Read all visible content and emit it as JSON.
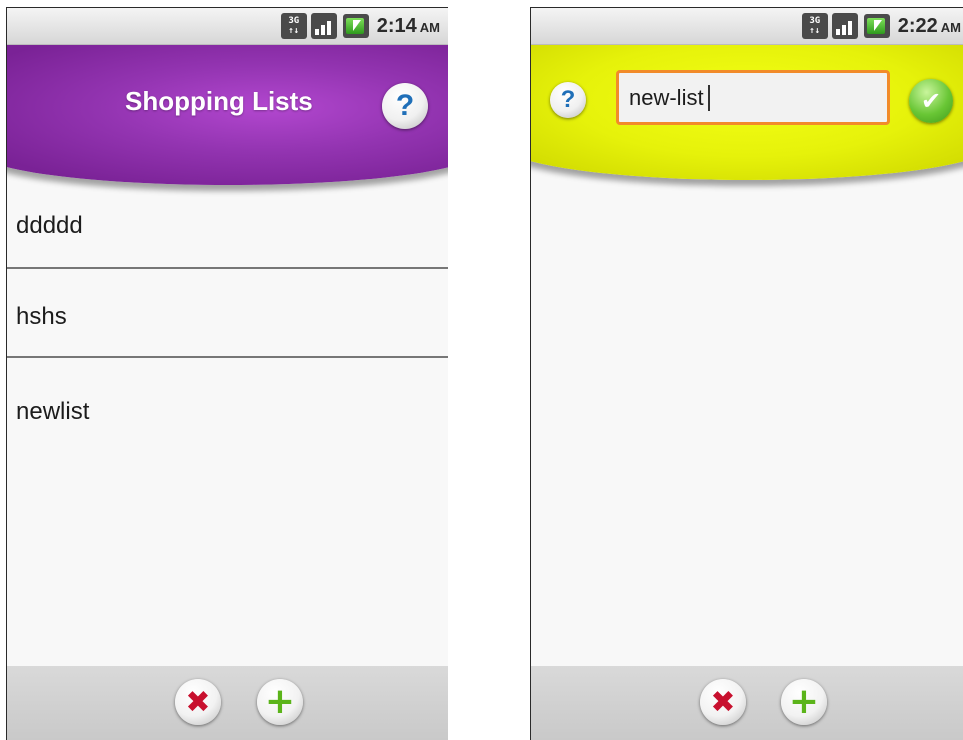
{
  "left_screen": {
    "status": {
      "network": "3G",
      "time": "2:14",
      "ampm": "AM"
    },
    "header": {
      "title": "Shopping Lists",
      "help_label": "?",
      "accent": "#9334b1"
    },
    "lists": [
      {
        "name": "ddddd"
      },
      {
        "name": "hshs"
      },
      {
        "name": "newlist"
      }
    ],
    "bottom": {
      "delete_icon": "x-icon",
      "add_icon": "plus-icon"
    }
  },
  "right_screen": {
    "status": {
      "network": "3G",
      "time": "2:22",
      "ampm": "AM"
    },
    "header": {
      "help_label": "?",
      "accent": "#e6f20a"
    },
    "name_input": {
      "value": "new-list"
    },
    "confirm_icon": "checkmark-icon",
    "bottom": {
      "delete_icon": "x-icon",
      "add_icon": "plus-icon"
    }
  }
}
